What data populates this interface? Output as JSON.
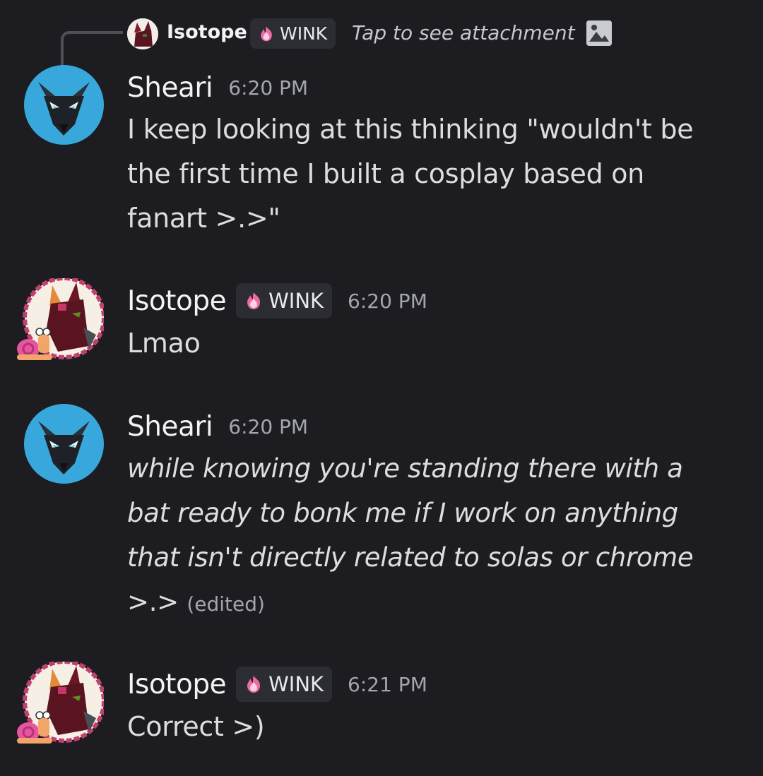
{
  "reply": {
    "author": "Isotope",
    "tag": "WINK",
    "text": "Tap to see attachment"
  },
  "messages": [
    {
      "author": "Sheari",
      "time": "6:20 PM",
      "lines": [
        "I keep looking at this thinking \"wouldn't be",
        "the first time I built a cosplay based on",
        "fanart >.>\""
      ]
    },
    {
      "author": "Isotope",
      "tag": "WINK",
      "time": "6:20 PM",
      "lines": [
        "Lmao"
      ]
    },
    {
      "author": "Sheari",
      "time": "6:20 PM",
      "lines": [
        "while knowing you're standing there with a",
        "bat ready to bonk me if I work on anything",
        "that isn't directly related to solas or chrome",
        ">.>"
      ],
      "edited": "(edited)"
    },
    {
      "author": "Isotope",
      "tag": "WINK",
      "time": "6:21 PM",
      "lines": [
        "Correct >)"
      ]
    }
  ],
  "colors": {
    "background": "#1c1c21",
    "sheari_avatar_bg": "#38a8dc",
    "tag_bg": "#2b2d33",
    "flame": "#f06aa6"
  },
  "icons": [
    "flame-icon",
    "image-icon",
    "wolf-avatar",
    "fox-avatar",
    "snail-decoration"
  ]
}
